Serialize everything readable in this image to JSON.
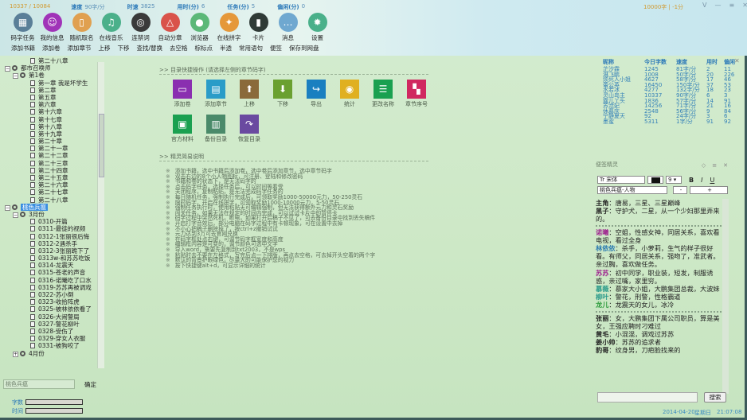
{
  "header": {
    "progress": "10337 / 10084",
    "stats": [
      {
        "label": "速度",
        "value": "90字/分"
      },
      {
        "label": "时速",
        "value": "3825"
      },
      {
        "label": "用时(分)",
        "value": "6"
      },
      {
        "label": "任务(分)",
        "value": "5"
      },
      {
        "label": "偏闲(分)",
        "value": "0"
      }
    ],
    "goal": "10000字 | -1分",
    "window_buttons": [
      "V",
      "—",
      "≡",
      "✕"
    ],
    "icons": [
      {
        "label": "码字任务",
        "color": "#5a7f98",
        "icon": "clapper-icon"
      },
      {
        "label": "我的信息",
        "color": "#a033b8",
        "icon": "user-icon"
      },
      {
        "label": "随机取名",
        "color": "#e0a050",
        "icon": "book-icon"
      },
      {
        "label": "在线音乐",
        "color": "#4bb08a",
        "icon": "music-icon"
      },
      {
        "label": "连禁词",
        "color": "#3a3a3a",
        "icon": "aperture-icon"
      },
      {
        "label": "自动分章",
        "color": "#d9534a",
        "icon": "compass-icon"
      },
      {
        "label": "浏览器",
        "color": "#5cb878",
        "icon": "location-icon"
      },
      {
        "label": "在线拼字",
        "color": "#e5983a",
        "icon": "runner-icon"
      },
      {
        "label": "卡片",
        "color": "#2f3a36",
        "icon": "bookmark-icon"
      },
      {
        "label": "消息",
        "color": "#6fa8d0",
        "icon": "chat-icon"
      },
      {
        "label": "设置",
        "color": "#4ab08a",
        "icon": "gear-icon"
      }
    ],
    "toolbar": [
      "添加书籍",
      "添加卷",
      "添加章节",
      "上移",
      "下移",
      "查找/替换",
      "去空格",
      "棕标点",
      "半透",
      "常用语句",
      "便签",
      "保存到网盘"
    ]
  },
  "tree": {
    "nodes": [
      {
        "level": 3,
        "type": "doc",
        "label": "第二十八章"
      },
      {
        "level": 1,
        "type": "book",
        "label": "都市召唤师",
        "toggle": "−"
      },
      {
        "level": 2,
        "type": "vol",
        "label": "第1卷",
        "toggle": "−"
      },
      {
        "level": 3,
        "type": "doc",
        "label": "第一章 我是坏学生"
      },
      {
        "level": 3,
        "type": "doc",
        "label": "第二章"
      },
      {
        "level": 3,
        "type": "doc",
        "label": "第五章"
      },
      {
        "level": 3,
        "type": "doc",
        "label": "第六章"
      },
      {
        "level": 3,
        "type": "doc",
        "label": "第十六章"
      },
      {
        "level": 3,
        "type": "doc",
        "label": "第十七章"
      },
      {
        "level": 3,
        "type": "doc",
        "label": "第十八章"
      },
      {
        "level": 3,
        "type": "doc",
        "label": "第十九章"
      },
      {
        "level": 3,
        "type": "doc",
        "label": "第二十章"
      },
      {
        "level": 3,
        "type": "doc",
        "label": "第二十一章"
      },
      {
        "level": 3,
        "type": "doc",
        "label": "第二十二章"
      },
      {
        "level": 3,
        "type": "doc",
        "label": "第二十三章"
      },
      {
        "level": 3,
        "type": "doc",
        "label": "第二十四章"
      },
      {
        "level": 3,
        "type": "doc",
        "label": "第二十五章"
      },
      {
        "level": 3,
        "type": "doc",
        "label": "第二十六章"
      },
      {
        "level": 3,
        "type": "doc",
        "label": "第二十七章"
      },
      {
        "level": 3,
        "type": "doc",
        "label": "第二十八章"
      },
      {
        "level": 1,
        "type": "book",
        "label": "桃色兵瘟",
        "toggle": "−",
        "selected": true
      },
      {
        "level": 2,
        "type": "vol",
        "label": "3月份",
        "toggle": "−"
      },
      {
        "level": 3,
        "type": "doc",
        "label": "0310-开篇"
      },
      {
        "level": 3,
        "type": "doc",
        "label": "0311-最徒的视频"
      },
      {
        "level": 3,
        "type": "doc",
        "label": "0312-1张丽很后悔"
      },
      {
        "level": 3,
        "type": "doc",
        "label": "0312-2遇杀手"
      },
      {
        "level": 3,
        "type": "doc",
        "label": "0312-3张丽跪下了"
      },
      {
        "level": 3,
        "type": "doc",
        "label": "0313w-和苏苏吃饭"
      },
      {
        "level": 3,
        "type": "doc",
        "label": "0314-龙震天"
      },
      {
        "level": 3,
        "type": "doc",
        "label": "0315-苍老的声音"
      },
      {
        "level": 3,
        "type": "doc",
        "label": "0316-诺曦吃了口水"
      },
      {
        "level": 3,
        "type": "doc",
        "label": "0319-苏苏再被调戏"
      },
      {
        "level": 3,
        "type": "doc",
        "label": "0322-苏小倒"
      },
      {
        "level": 3,
        "type": "doc",
        "label": "0323-收拾阵虎"
      },
      {
        "level": 3,
        "type": "doc",
        "label": "0325-被林依依看了"
      },
      {
        "level": 3,
        "type": "doc",
        "label": "0326-大闹警局"
      },
      {
        "level": 3,
        "type": "doc",
        "label": "0327-警花柳叶"
      },
      {
        "level": 3,
        "type": "doc",
        "label": "0328-受伤了"
      },
      {
        "level": 3,
        "type": "doc",
        "label": "0329-穿女人衣服"
      },
      {
        "level": 3,
        "type": "doc",
        "label": "0331-被狗咬了"
      },
      {
        "level": 2,
        "type": "vol",
        "label": "4月份",
        "toggle": "+"
      }
    ]
  },
  "bottom_left": {
    "book_input": "桃色兵瘟",
    "ok": "确定",
    "words_label": "字数",
    "time_label": "时间",
    "words_progress": 0,
    "time_progress": 0
  },
  "quick": {
    "title": "目录快捷操作 (请选择左侧的章节码字)",
    "items": [
      {
        "label": "添加卷",
        "color": "#8a2fb0",
        "icon": "folder-icon"
      },
      {
        "label": "添加章节",
        "color": "#2a9cc8",
        "icon": "document-icon"
      },
      {
        "label": "上移",
        "color": "#8a6a3a",
        "icon": "arrow-up-icon"
      },
      {
        "label": "下移",
        "color": "#6aa030",
        "icon": "arrow-down-icon"
      },
      {
        "label": "导出",
        "color": "#1a7fc0",
        "icon": "export-icon"
      },
      {
        "label": "统计",
        "color": "#e0b020",
        "icon": "chrome-icon"
      },
      {
        "label": "更改名称",
        "color": "#1aa050",
        "icon": "rename-icon"
      },
      {
        "label": "章节序号",
        "color": "#d02860",
        "icon": "grid-icon"
      },
      {
        "label": "官方材料",
        "color": "#1aa050",
        "icon": "material-icon"
      },
      {
        "label": "备份目录",
        "color": "#4a8a6a",
        "icon": "save-icon"
      },
      {
        "label": "恢复目录",
        "color": "#6a4aa0",
        "icon": "restore-icon"
      }
    ]
  },
  "help": {
    "title": "精灵简易说明",
    "lines": [
      "添加书籍，选中书籍后添加卷，选中卷后添加章节，选中章节码字",
      "双击右边的8个小人物图标，可注册、登陆和修改密码",
      "书籍和卷的状态下，是无法码字的",
      "点击码字任务，选择任务后，可以时间等着受",
      "关闭程序，复制粘贴，是无法完成码字任务的",
      "每日随机任务，强制执行完成后，可领取奖励1000-50000元力，50-250灵石",
      "限时码字，开启在线拼字，可领取奖励1000-10000元力，5-50灵石",
      "强制任务执行时，使用粘贴无可编辑强制，但无法获得额外元力和灵石奖励",
      "闯关任务，如果无法在规定的时间内完成，可以试试卡片中的暂停卡",
      "码字过程中突然死机，断电，如果打开后稿子不见了，可去备份目录中找到丢失稿件",
      "开启打字音效后，部分电脑在码字过程中有卡顿现象，可在设置中去掉",
      "不小心把稿子删除掉了，按ctrl+z撤销试试",
      "元力达到3万可去官网兑换",
      "在码字框处点右键，可调节码字框宽度和高度",
      "编辑框内容是可变的，调节颜色可选中文字",
      "导入word，需要先复制到txt2003，不是wps",
      "粘贴时去不要在左格式，写完后点一下排版，再点去空格，可去掉开头空着的两个字",
      "默认的背景护眼绿色，尽量大的可能保护您的视力",
      "按下快捷键alt+d，可显示详细的统计"
    ]
  },
  "ranking": {
    "headers": [
      "昵称",
      "今日字数",
      "速度",
      "用时",
      "偏闲"
    ],
    "rows": [
      [
        "芷汐霖",
        "1245",
        "81字/分",
        "2",
        "11"
      ],
      [
        "淋飞鹏",
        "1008",
        "50字/分",
        "20",
        "226"
      ],
      [
        "烦死人小姐",
        "4627",
        "58字/分",
        "17",
        "46"
      ],
      [
        "蕾公英",
        "16450",
        "150字/分",
        "37",
        "53"
      ],
      [
        "水若冰",
        "4277",
        "132字/分",
        "18",
        "23"
      ],
      [
        "灵山岛主",
        "10337",
        "90字/分",
        "6",
        "3"
      ],
      [
        "露儿丫头",
        "1836",
        "57字/分",
        "14",
        "91"
      ],
      [
        "苏沧妃",
        "14256",
        "71字/分",
        "21",
        "16"
      ],
      [
        "休慕庆",
        "2548",
        "56字/分",
        "9",
        "84"
      ],
      [
        "宁静夏天",
        "92",
        "24字/分",
        "3",
        "6"
      ],
      [
        "墨蜜",
        "5311",
        "1字/分",
        "91",
        "92"
      ]
    ]
  },
  "notes": {
    "title": "便签精灵",
    "font": "宋体",
    "color": "#111111",
    "size": "9",
    "style_buttons": [
      "B",
      "I",
      "U"
    ],
    "doc": "桃色兵瘟-人物",
    "minus": "-",
    "plus": "+",
    "entries": [
      {
        "name": "主角",
        "color": "#222222",
        "text": "：唐易，三星、三星巅峰"
      },
      {
        "name": "黑子",
        "color": "#222222",
        "text": "：守护犬，二星，从一个少妇那里弄来的。"
      },
      {
        "divider": true
      },
      {
        "name": "诺曦",
        "color": "#a02890",
        "text": "：空姐，性感女神，同居关系，喜欢看电视，看过全身"
      },
      {
        "name": "林依依",
        "color": "#2a7ab0",
        "text": "：杀手，小萝莉，生气的样子很好看。有师父，同居关系，强吻了，准武者。亲过胸，喜欢做任务。"
      },
      {
        "name": "苏苏",
        "color": "#a02890",
        "text": "：初中同学，职业装，短发，制服诱惑，亲过嘴，家里穷。"
      },
      {
        "name": "慕薇",
        "color": "#2a9a8a",
        "text": "：慕家大小姐，大鹏集团总裁，大波妹"
      },
      {
        "name": "柳叶",
        "color": "#2a9a8a",
        "text": "：警花，刑警，性格霸道"
      },
      {
        "name": "龙儿",
        "color": "#2a9a3a",
        "text": "：龙震天的女儿，冰冷"
      },
      {
        "divider": true
      },
      {
        "name": "张丽",
        "color": "#222222",
        "text": "：女，大鹏集团下属公司职员，算是美女，王强应聘时刁难过"
      },
      {
        "name": "黄毛",
        "color": "#222222",
        "text": "：小混混，调戏过苏苏"
      },
      {
        "name": "姜小帅",
        "color": "#222222",
        "text": "：苏苏的追求者"
      },
      {
        "name": "豹哥",
        "color": "#222222",
        "text": "：纹身男，刀疤脸找来的"
      }
    ],
    "search_value": "",
    "search_button": "搜索"
  },
  "status": {
    "date": "2014-04-20",
    "weekday": "星期日",
    "time": "21:07:08"
  }
}
